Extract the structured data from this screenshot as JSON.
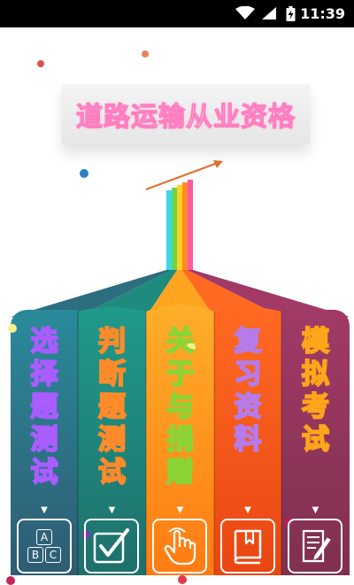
{
  "status_bar": {
    "time": "11:39"
  },
  "title": "道路运输从业资格",
  "colors": {
    "banner_text_stroke": "#ff7fc0",
    "column_1": "#2d5e6e",
    "column_2": "#1f7a72",
    "column_3": "#ff8a1a",
    "column_4": "#f04c1a",
    "column_5": "#8a3655"
  },
  "menu": [
    {
      "label": [
        "选",
        "择",
        "题",
        "测",
        "试"
      ],
      "color": "#a95cff",
      "icon": "abc-icon",
      "abc": [
        "A",
        "B",
        "C"
      ]
    },
    {
      "label": [
        "判",
        "断",
        "题",
        "测",
        "试"
      ],
      "color": "#ff8a2a",
      "icon": "checkbox-icon"
    },
    {
      "label": [
        "关",
        "于",
        "与",
        "捐",
        "赠"
      ],
      "color": "#8bd435",
      "icon": "hand-pointer-icon"
    },
    {
      "label": [
        "复",
        "习",
        "资",
        "料"
      ],
      "color": "#b57ce9",
      "icon": "book-icon"
    },
    {
      "label": [
        "模",
        "拟",
        "考",
        "试"
      ],
      "color": "#ffa51a",
      "icon": "exam-paper-icon"
    }
  ]
}
